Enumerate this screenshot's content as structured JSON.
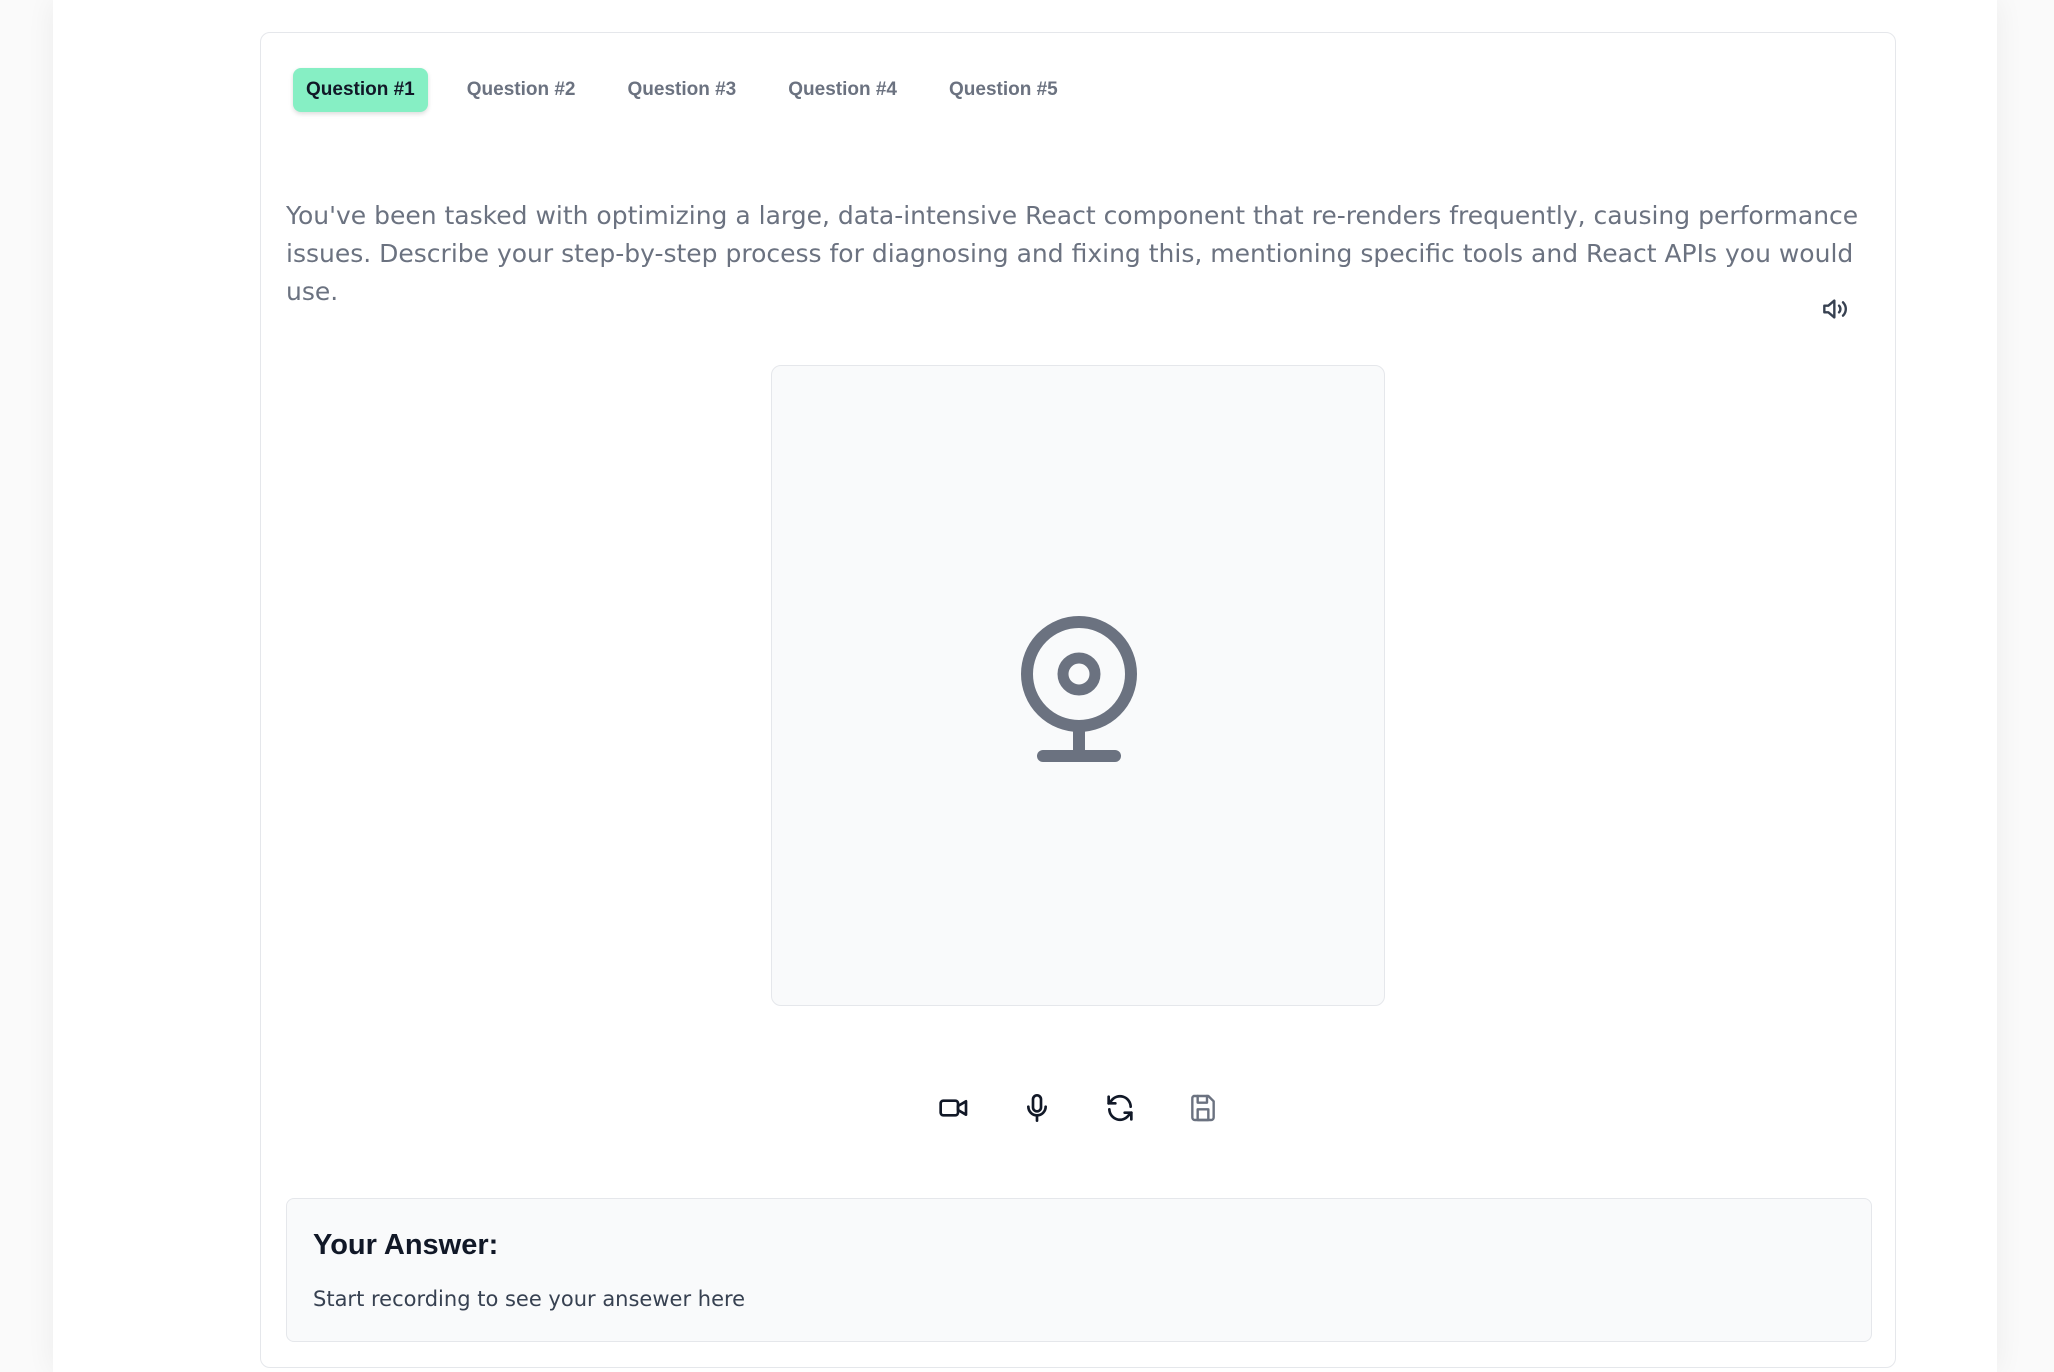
{
  "tabs": [
    {
      "label": "Question #1",
      "active": true
    },
    {
      "label": "Question #2",
      "active": false
    },
    {
      "label": "Question #3",
      "active": false
    },
    {
      "label": "Question #4",
      "active": false
    },
    {
      "label": "Question #5",
      "active": false
    }
  ],
  "question": {
    "text": "You've been tasked with optimizing a large, data-intensive React component that re-renders frequently, causing performance issues. Describe your step-by-step process for diagnosing and fixing this, mentioning specific tools and React APIs you would use."
  },
  "icons": {
    "speaker": "volume-icon",
    "webcam": "webcam-icon",
    "video": "video-camera-icon",
    "mic": "microphone-icon",
    "refresh": "refresh-icon",
    "save": "save-icon"
  },
  "answer": {
    "title": "Your Answer:",
    "placeholder": "Start recording to see your ansewer here"
  },
  "colors": {
    "active_tab": "#86efc4",
    "icon_gray": "#6b7280",
    "icon_dark": "#111827"
  }
}
